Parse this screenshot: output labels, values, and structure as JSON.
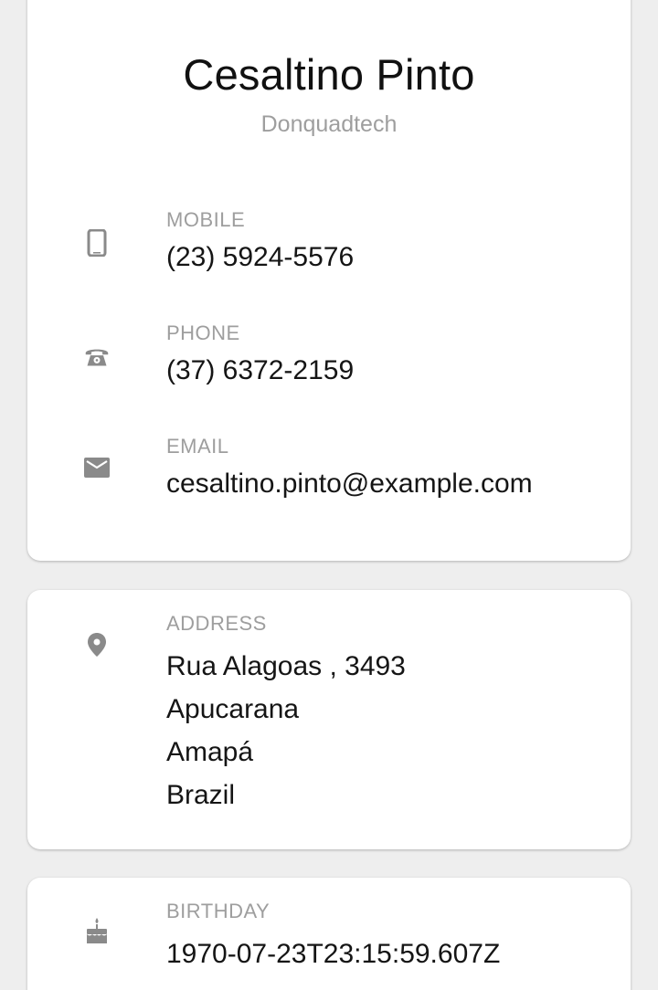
{
  "profile": {
    "name": "Cesaltino Pinto",
    "company": "Donquadtech"
  },
  "contact": {
    "mobile": {
      "label": "MOBILE",
      "value": "(23) 5924-5576",
      "icon": "smartphone-icon"
    },
    "phone": {
      "label": "PHONE",
      "value": "(37) 6372-2159",
      "icon": "telephone-icon"
    },
    "email": {
      "label": "EMAIL",
      "value": "cesaltino.pinto@example.com",
      "icon": "envelope-icon"
    }
  },
  "address": {
    "label": "ADDRESS",
    "icon": "map-pin-icon",
    "lines": [
      "Rua Alagoas , 3493",
      "Apucarana",
      "Amapá",
      "Brazil"
    ]
  },
  "birthday": {
    "label": "BIRTHDAY",
    "icon": "cake-icon",
    "value": "1970-07-23T23:15:59.607Z"
  },
  "colors": {
    "background": "#eeeeee",
    "card": "#ffffff",
    "icon": "#8a8a8a",
    "label": "#9e9e9e",
    "text": "#151515"
  }
}
